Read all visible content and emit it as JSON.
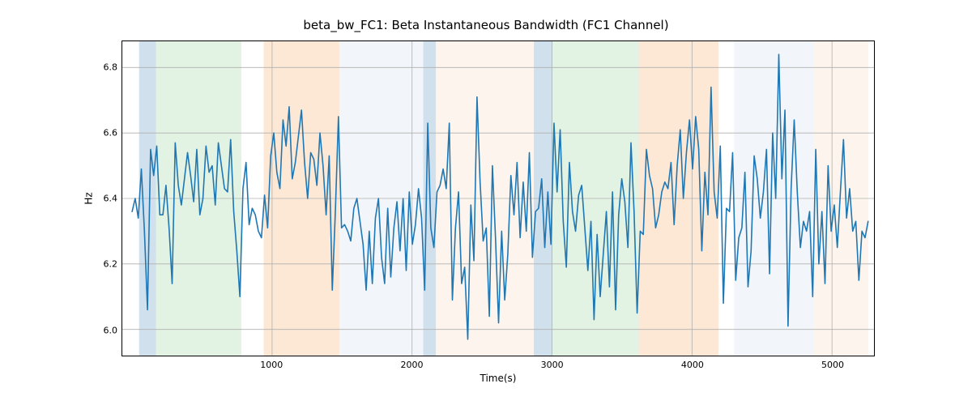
{
  "chart_data": {
    "type": "line",
    "title": "beta_bw_FC1: Beta Instantaneous Bandwidth (FC1 Channel)",
    "xlabel": "Time(s)",
    "ylabel": "Hz",
    "xlim": [
      -70,
      5300
    ],
    "ylim": [
      5.92,
      6.88
    ],
    "xticks": [
      1000,
      2000,
      3000,
      4000,
      5000
    ],
    "yticks": [
      6.0,
      6.2,
      6.4,
      6.6,
      6.8
    ],
    "bands": [
      {
        "x0": 50,
        "x1": 170,
        "color": "#6da0c8"
      },
      {
        "x0": 170,
        "x1": 780,
        "color": "#a5d6a7"
      },
      {
        "x0": 940,
        "x1": 1480,
        "color": "#f9b97b"
      },
      {
        "x0": 1480,
        "x1": 2080,
        "color": "#d6e4f0"
      },
      {
        "x0": 2080,
        "x1": 2170,
        "color": "#6da0c8"
      },
      {
        "x0": 2170,
        "x1": 2870,
        "color": "#f8e0c7"
      },
      {
        "x0": 2870,
        "x1": 3000,
        "color": "#6da0c8"
      },
      {
        "x0": 3000,
        "x1": 3620,
        "color": "#a5d6a7"
      },
      {
        "x0": 3620,
        "x1": 4190,
        "color": "#f9b97b"
      },
      {
        "x0": 4190,
        "x1": 4300,
        "color": "#ffffff"
      },
      {
        "x0": 4300,
        "x1": 4870,
        "color": "#d6e4f0"
      },
      {
        "x0": 4870,
        "x1": 5260,
        "color": "#f8e0c7"
      }
    ],
    "series": [
      {
        "name": "beta_bw_FC1",
        "color": "#1f77b4",
        "x_step": 22,
        "x_start": 0,
        "values": [
          6.36,
          6.4,
          6.34,
          6.49,
          6.3,
          6.06,
          6.55,
          6.47,
          6.56,
          6.35,
          6.35,
          6.44,
          6.31,
          6.14,
          6.57,
          6.44,
          6.38,
          6.46,
          6.54,
          6.47,
          6.39,
          6.55,
          6.35,
          6.4,
          6.56,
          6.48,
          6.5,
          6.38,
          6.57,
          6.5,
          6.43,
          6.42,
          6.58,
          6.36,
          6.24,
          6.1,
          6.43,
          6.51,
          6.32,
          6.37,
          6.35,
          6.3,
          6.28,
          6.41,
          6.31,
          6.53,
          6.6,
          6.48,
          6.43,
          6.64,
          6.56,
          6.68,
          6.46,
          6.51,
          6.59,
          6.67,
          6.51,
          6.4,
          6.54,
          6.52,
          6.44,
          6.6,
          6.5,
          6.35,
          6.53,
          6.12,
          6.36,
          6.65,
          6.31,
          6.32,
          6.3,
          6.27,
          6.37,
          6.4,
          6.33,
          6.26,
          6.12,
          6.3,
          6.14,
          6.34,
          6.4,
          6.22,
          6.14,
          6.37,
          6.16,
          6.31,
          6.39,
          6.24,
          6.4,
          6.18,
          6.42,
          6.26,
          6.32,
          6.43,
          6.34,
          6.12,
          6.63,
          6.31,
          6.25,
          6.42,
          6.44,
          6.49,
          6.43,
          6.63,
          6.09,
          6.31,
          6.42,
          6.14,
          6.19,
          5.97,
          6.38,
          6.21,
          6.71,
          6.45,
          6.27,
          6.31,
          6.04,
          6.5,
          6.28,
          6.02,
          6.3,
          6.09,
          6.23,
          6.47,
          6.35,
          6.51,
          6.28,
          6.45,
          6.3,
          6.54,
          6.22,
          6.36,
          6.37,
          6.46,
          6.25,
          6.42,
          6.26,
          6.63,
          6.42,
          6.61,
          6.33,
          6.19,
          6.51,
          6.36,
          6.3,
          6.41,
          6.44,
          6.31,
          6.18,
          6.33,
          6.03,
          6.29,
          6.1,
          6.23,
          6.36,
          6.13,
          6.42,
          6.06,
          6.35,
          6.46,
          6.39,
          6.25,
          6.57,
          6.36,
          6.05,
          6.3,
          6.29,
          6.55,
          6.47,
          6.43,
          6.31,
          6.35,
          6.42,
          6.45,
          6.43,
          6.51,
          6.32,
          6.5,
          6.61,
          6.4,
          6.54,
          6.64,
          6.49,
          6.65,
          6.55,
          6.24,
          6.48,
          6.35,
          6.74,
          6.42,
          6.34,
          6.56,
          6.08,
          6.37,
          6.36,
          6.54,
          6.15,
          6.28,
          6.31,
          6.48,
          6.13,
          6.24,
          6.53,
          6.46,
          6.34,
          6.42,
          6.55,
          6.17,
          6.6,
          6.4,
          6.84,
          6.46,
          6.67,
          6.01,
          6.43,
          6.64,
          6.42,
          6.25,
          6.33,
          6.3,
          6.36,
          6.1,
          6.55,
          6.2,
          6.36,
          6.14,
          6.5,
          6.3,
          6.38,
          6.25,
          6.42,
          6.58,
          6.34,
          6.43,
          6.3,
          6.33,
          6.15,
          6.3,
          6.28,
          6.33
        ]
      }
    ]
  }
}
